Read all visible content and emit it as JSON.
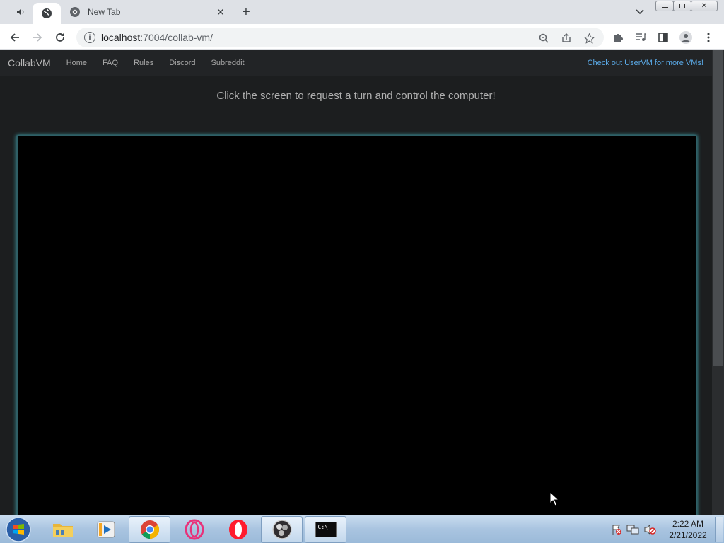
{
  "browser": {
    "tabs": [
      {
        "title": "",
        "icon": "speaker-icon"
      },
      {
        "title": "",
        "icon": "globe-icon"
      },
      {
        "title": "New Tab",
        "icon": "chrome-icon"
      }
    ],
    "new_tab_label": "+",
    "url": {
      "host": "localhost",
      "path": ":7004/collab-vm/"
    }
  },
  "site": {
    "brand": "CollabVM",
    "nav": [
      "Home",
      "FAQ",
      "Rules",
      "Discord",
      "Subreddit"
    ],
    "promo": "Check out UserVM for more VMs!",
    "prompt": "Click the screen to request a turn and control the computer!"
  },
  "taskbar": {
    "apps": [
      {
        "name": "windows-explorer"
      },
      {
        "name": "media-player"
      },
      {
        "name": "google-chrome",
        "active": true
      },
      {
        "name": "opera-gx"
      },
      {
        "name": "opera"
      },
      {
        "name": "obs"
      },
      {
        "name": "command-prompt",
        "active": true
      }
    ],
    "cmd_label": "C:\\_",
    "clock": {
      "time": "2:22 AM",
      "date": "2/21/2022"
    }
  },
  "colors": {
    "page_bg": "#1c1e1f",
    "accent_link": "#5aa9e6",
    "vm_border_glow": "#3ea6b0"
  }
}
